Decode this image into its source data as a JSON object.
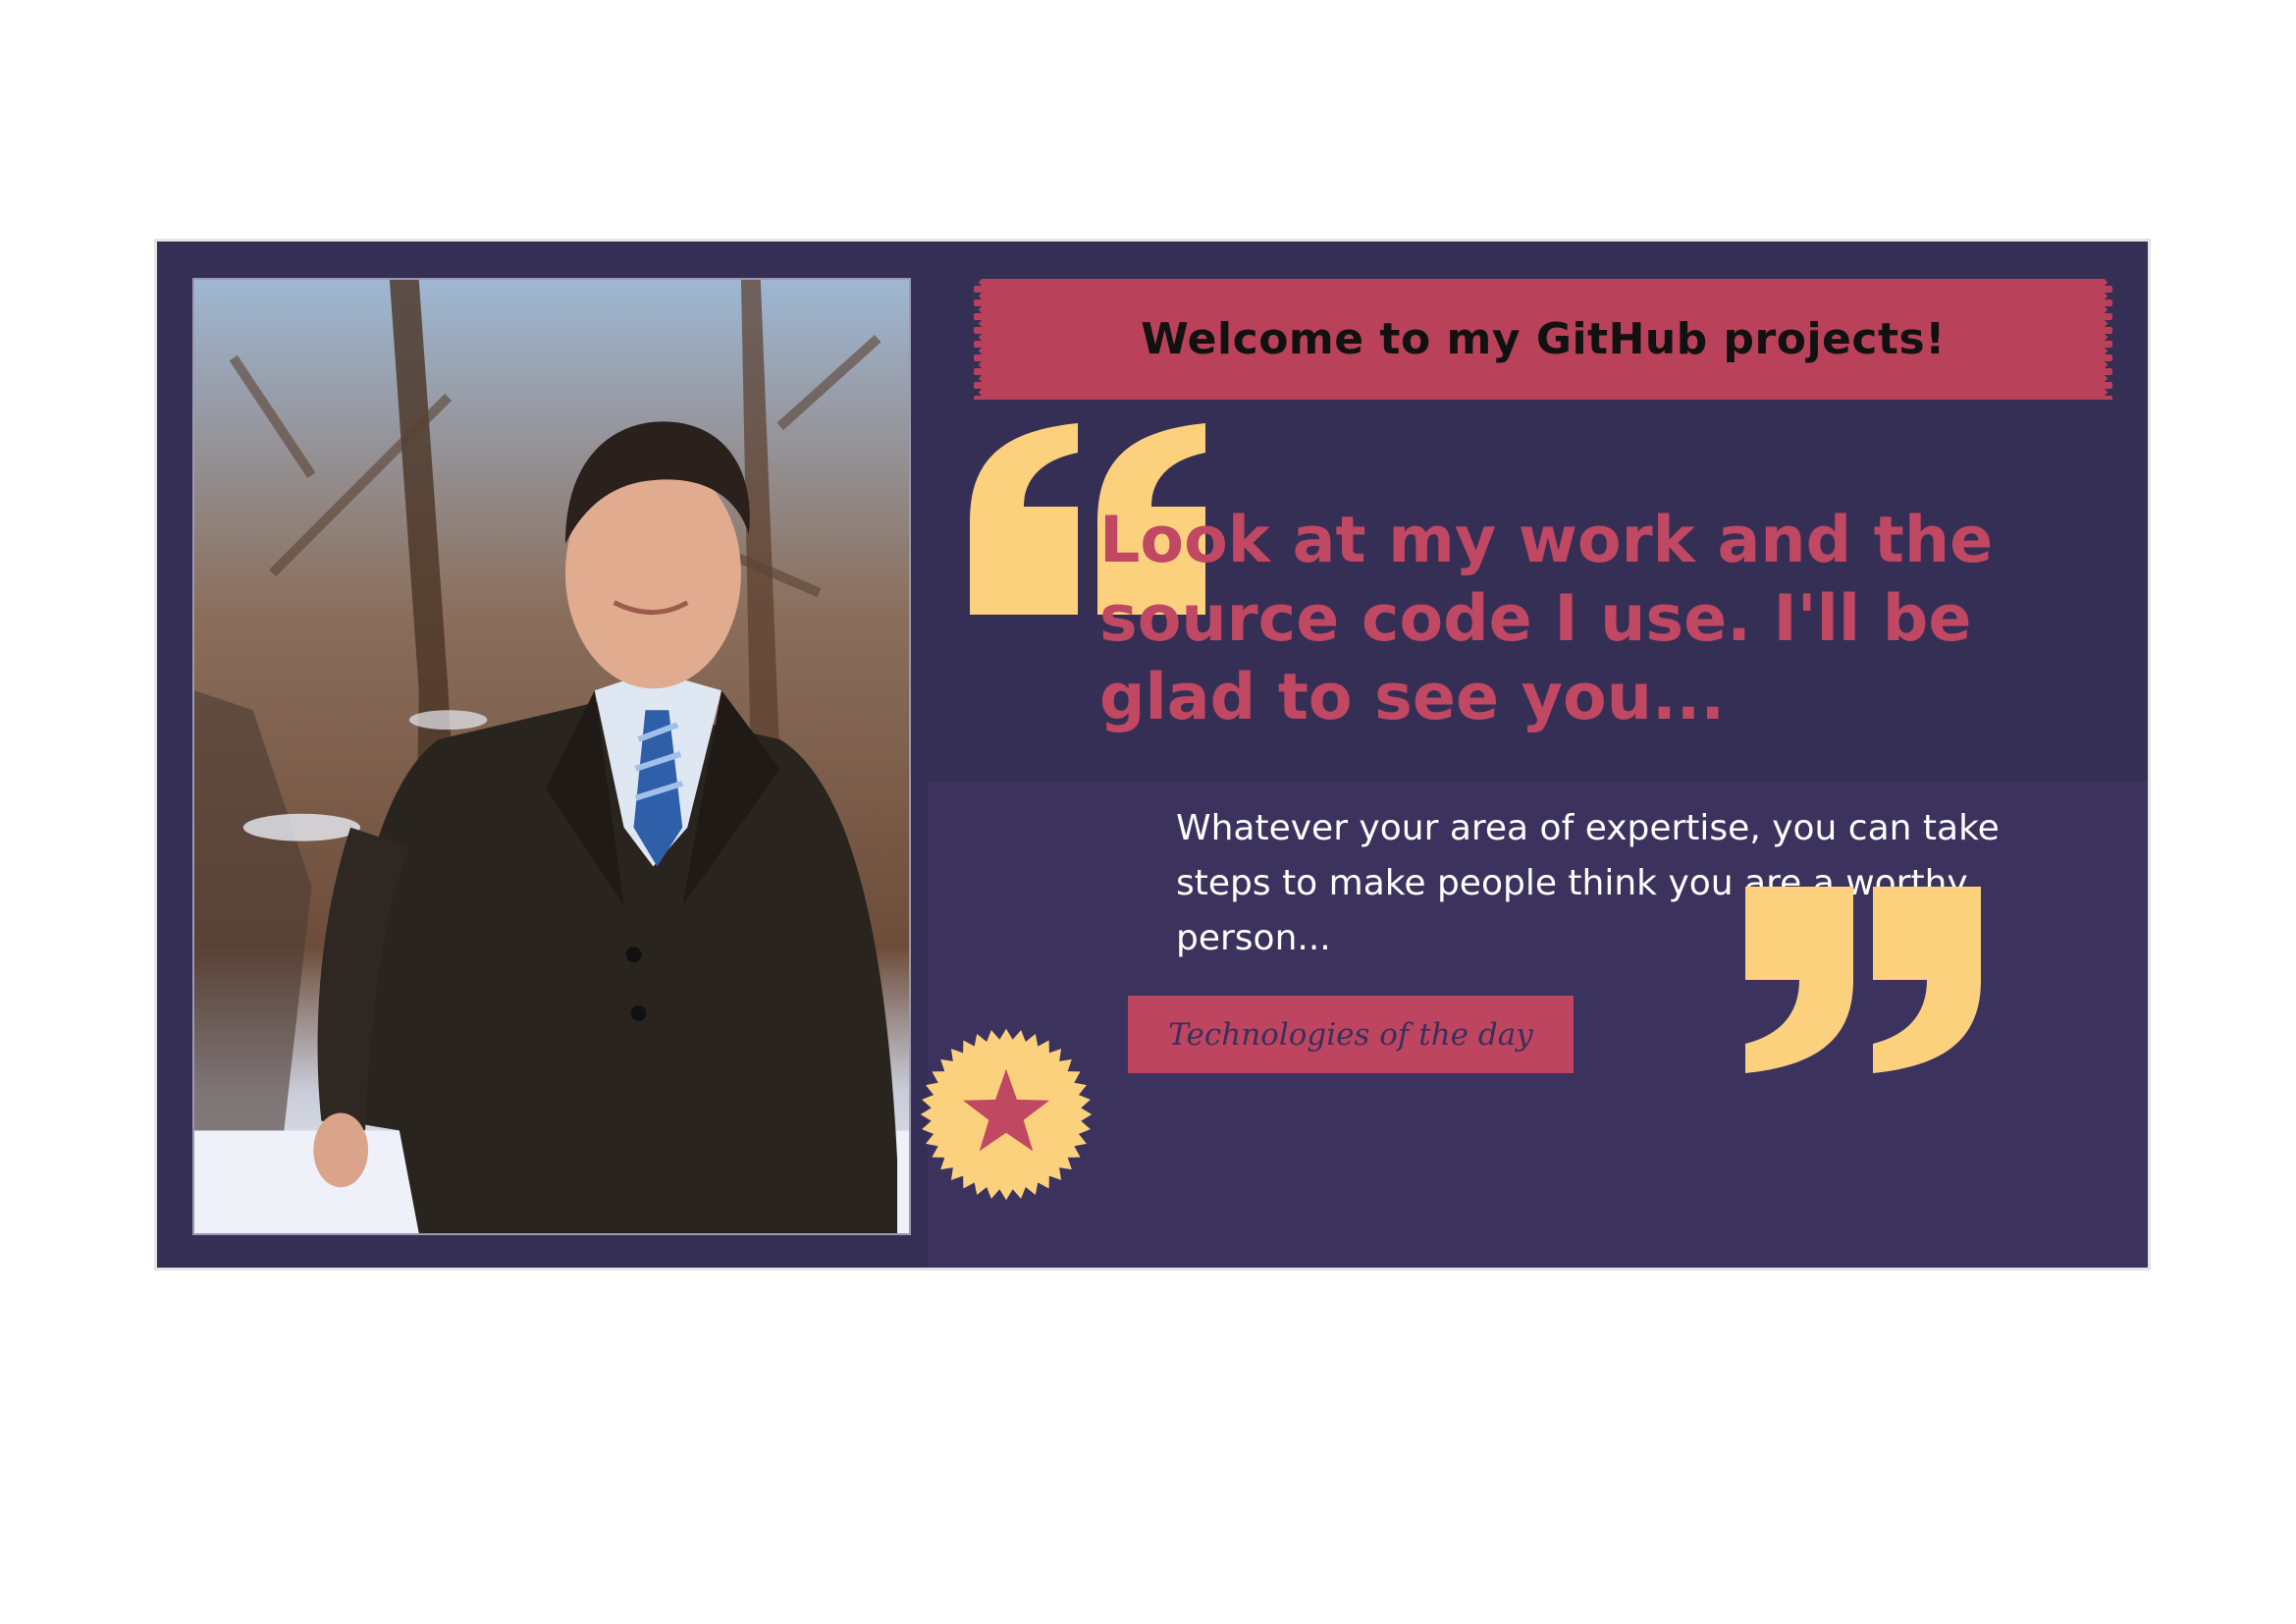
{
  "banner": {
    "title": "Welcome to my GitHub projects!"
  },
  "headline": "Look at my work and the source code I use. I'll be glad to see you...",
  "body": "Whatever your area of expertise, you can take steps to make people think you are a worthy person...",
  "button": {
    "label": "Technologies of the day"
  },
  "icons": {
    "open_quote": "open-quote-icon",
    "close_quote": "close-quote-icon",
    "badge": "star-badge-icon"
  },
  "colors": {
    "card_background": "#362f55",
    "banner": "#b9425a",
    "headline": "#c04862",
    "quote_marks": "#fbd17e",
    "button": "#bd4560"
  }
}
